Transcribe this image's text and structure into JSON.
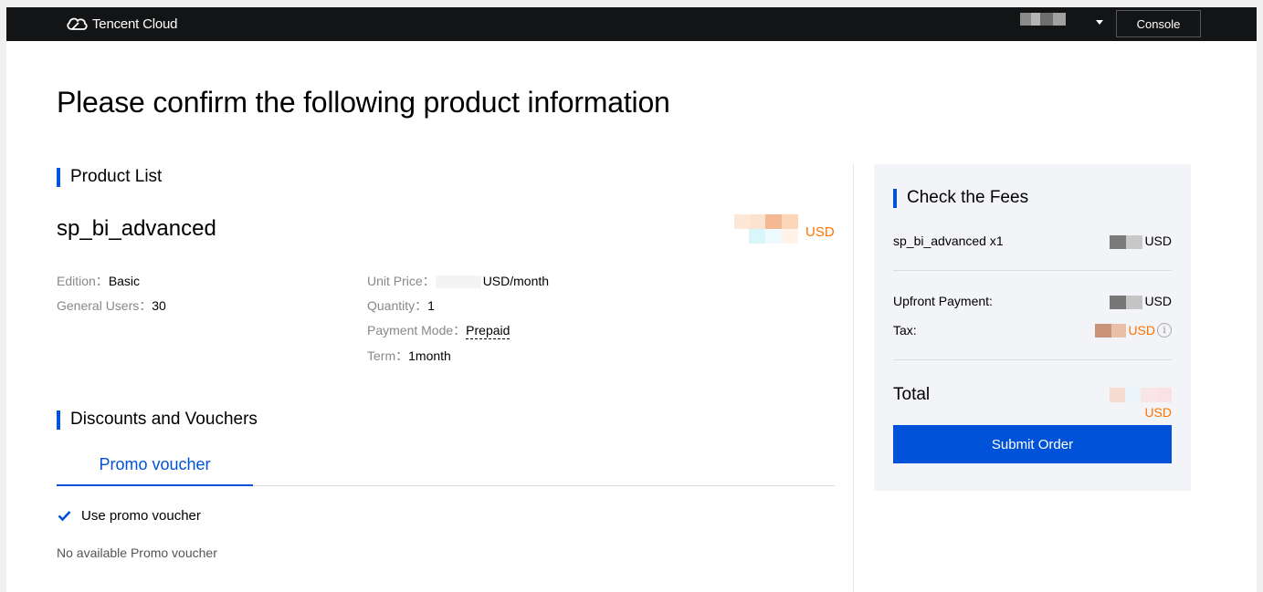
{
  "header": {
    "brand": "Tencent Cloud",
    "console_label": "Console"
  },
  "page": {
    "title": "Please confirm the following product information"
  },
  "product_list": {
    "heading": "Product List",
    "product_name": "sp_bi_advanced",
    "price_currency": "USD",
    "specs_left": [
      {
        "label": "Edition：",
        "value": "Basic"
      },
      {
        "label": "General Users：",
        "value": "30"
      }
    ],
    "unit_price_label": "Unit Price：",
    "unit_price_unit": "USD/month",
    "quantity_label": "Quantity：",
    "quantity_value": "1",
    "payment_mode_label": "Payment Mode：",
    "payment_mode_value": "Prepaid",
    "term_label": "Term：",
    "term_value": "1month"
  },
  "discounts": {
    "heading": "Discounts and Vouchers",
    "tab_label": "Promo voucher",
    "use_voucher_label": "Use promo voucher",
    "use_voucher_checked": true,
    "empty_text": "No available Promo voucher"
  },
  "fees": {
    "heading": "Check the Fees",
    "item_label": "sp_bi_advanced x1",
    "item_currency": "USD",
    "upfront_label": "Upfront Payment:",
    "upfront_currency": "USD",
    "tax_label": "Tax:",
    "tax_currency": "USD",
    "total_label": "Total",
    "total_currency": "USD",
    "submit_label": "Submit Order"
  },
  "colors": {
    "accent": "#0052d9",
    "price": "#ff7200",
    "nav_bg": "#131416"
  }
}
